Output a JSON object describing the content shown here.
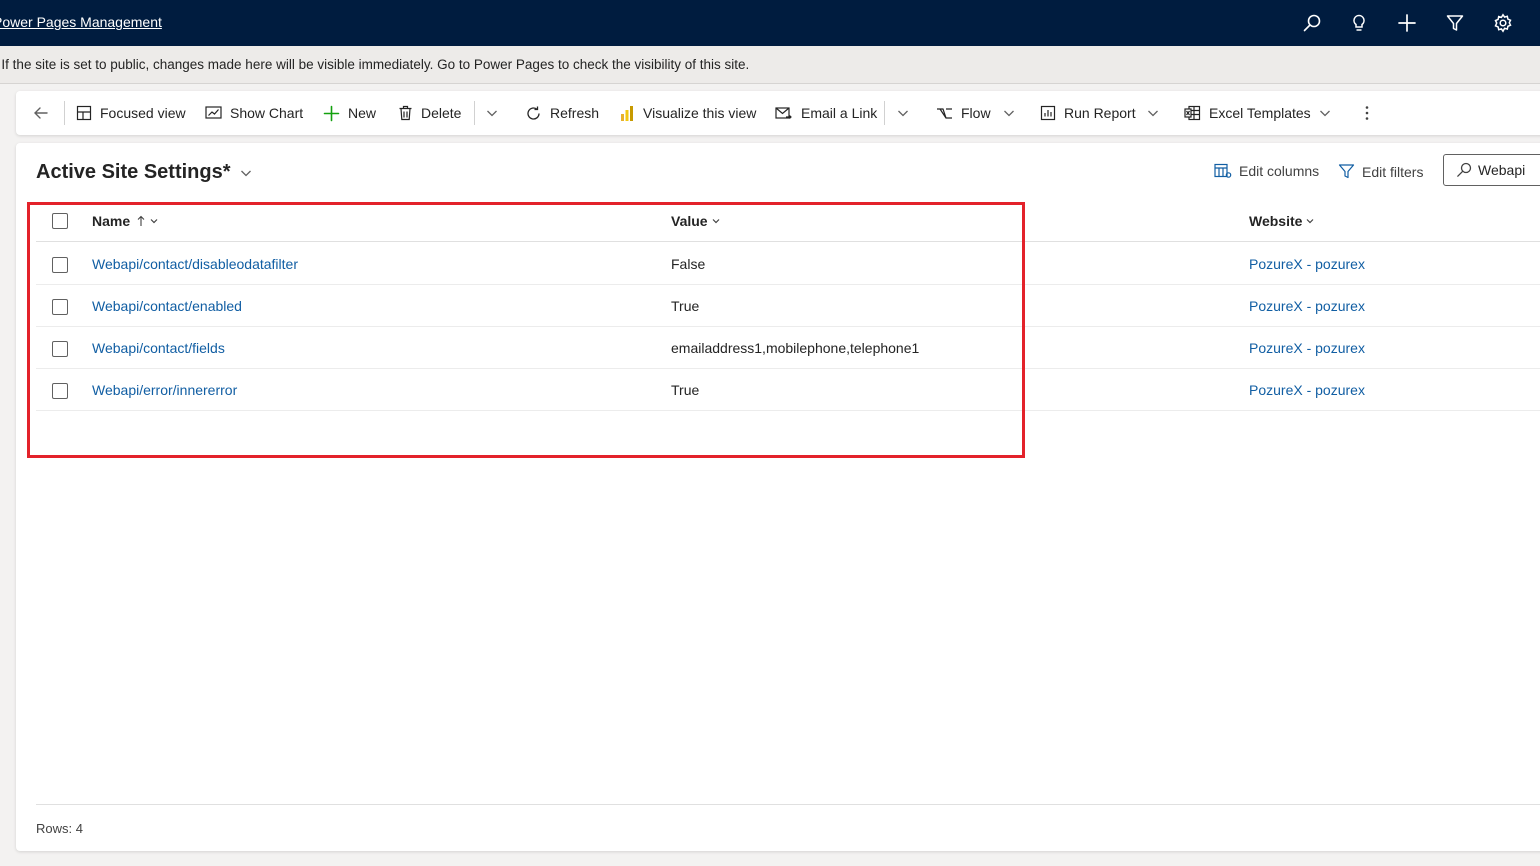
{
  "app": {
    "title": "Power Pages Management"
  },
  "top_icons": [
    "search-icon",
    "lightbulb-icon",
    "plus-icon",
    "filter-icon",
    "settings-icon"
  ],
  "notice": {
    "text": "Review this site's visibility before editing. If the site is set to public, changes made here will be visible immediately. Go to Power Pages to check the visibility of this site."
  },
  "toolbar": {
    "focused_view": "Focused view",
    "show_chart": "Show Chart",
    "new": "New",
    "delete": "Delete",
    "refresh": "Refresh",
    "visualize": "Visualize this view",
    "email_link": "Email a Link",
    "flow": "Flow",
    "run_report": "Run Report",
    "excel_templates": "Excel Templates"
  },
  "view": {
    "title": "Active Site Settings*",
    "edit_columns": "Edit columns",
    "edit_filters": "Edit filters",
    "search_value": "Webapi"
  },
  "grid": {
    "columns": [
      "Name",
      "Value",
      "Website"
    ],
    "sort": "ascending",
    "rows": [
      {
        "name": "Webapi/contact/disableodatafilter",
        "value": "False",
        "website": "PozureX - pozurex"
      },
      {
        "name": "Webapi/contact/enabled",
        "value": "True",
        "website": "PozureX - pozurex"
      },
      {
        "name": "Webapi/contact/fields",
        "value": "emailaddress1,mobilephone,telephone1",
        "website": "PozureX - pozurex"
      },
      {
        "name": "Webapi/error/innererror",
        "value": "True",
        "website": "PozureX - pozurex"
      }
    ]
  },
  "footer": {
    "rows_label": "Rows: 4"
  },
  "colors": {
    "header_bg": "#001c3f",
    "link": "#115ea3",
    "highlight": "#e3222a"
  }
}
